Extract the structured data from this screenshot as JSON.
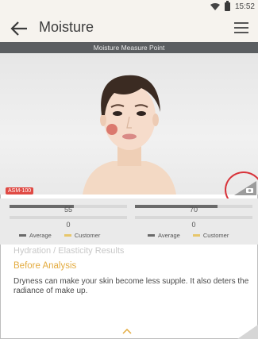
{
  "status": {
    "time": "15:52"
  },
  "app": {
    "title": "Moisture",
    "back_icon": "arrow-left-icon",
    "menu_icon": "hamburger-menu-icon"
  },
  "header": {
    "strip_text": "Moisture Measure Point"
  },
  "device": {
    "label": "ASM-100",
    "camera_icon": "camera-icon"
  },
  "measure": {
    "left": {
      "average_value": "55",
      "customer_value": "0",
      "average_fill_fraction": 0.55,
      "customer_fill_fraction": 0.0
    },
    "right": {
      "average_value": "70",
      "customer_value": "0",
      "average_fill_fraction": 0.7,
      "customer_fill_fraction": 0.0
    },
    "legend": {
      "average": "Average",
      "customer": "Customer"
    },
    "colors": {
      "average": "#6a6a6a",
      "customer": "#e7c66b"
    }
  },
  "results": {
    "title": "Hydration / Elasticity Results",
    "subtitle": "Before Analysis",
    "text": "Dryness can make your skin become less supple. It also deters the radiance of make up."
  },
  "nav": {
    "expand_icon": "chevron-up-icon"
  },
  "accent": "#e3ab3f"
}
